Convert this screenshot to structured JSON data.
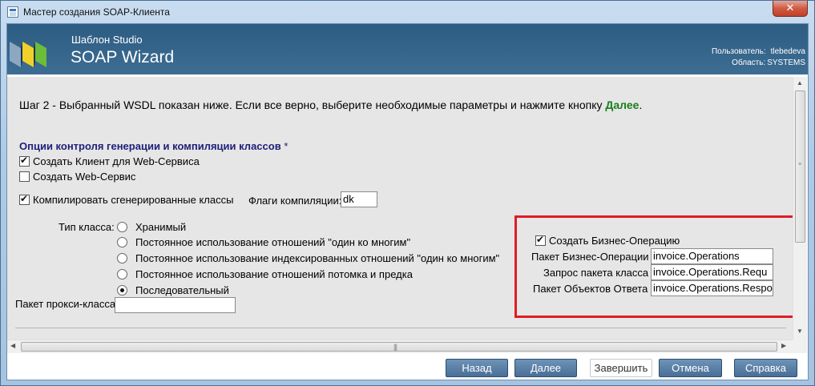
{
  "window": {
    "title": "Мастер создания SOAP-Клиента",
    "close_label": "✕"
  },
  "header": {
    "brand_small": "Шаблон Studio",
    "brand_big": "SOAP Wizard",
    "user_label": "Пользователь:",
    "user_value": "tlebedeva",
    "area_label": "Область:",
    "area_value": "SYSTEMS"
  },
  "content": {
    "step_text": "Шаг 2 - Выбранный WSDL показан ниже. Если все верно, выберите необходимые параметры и нажмите кнопку ",
    "step_next_word": "Далее",
    "step_end": ".",
    "section_title": "Опции контроля генерации и компиляции классов",
    "section_required": "*",
    "create_client_label": "Создать Клиент для Web-Сервиса",
    "create_client_checked": true,
    "create_service_label": "Создать Web-Сервис",
    "create_service_checked": false,
    "compile_label": "Компилировать сгенерированные классы",
    "compile_checked": true,
    "compile_flags_label": "Флаги компиляции:",
    "compile_flags_value": "dk",
    "class_type_label": "Тип класса:",
    "class_types": [
      {
        "label": "Хранимый",
        "checked": false
      },
      {
        "label": "Постоянное использование отношений \"один ко многим\"",
        "checked": false
      },
      {
        "label": "Постоянное использование индексированных отношений \"один ко многим\"",
        "checked": false
      },
      {
        "label": "Постоянное использование отношений потомка и предка",
        "checked": false
      },
      {
        "label": "Последовательный",
        "checked": true
      }
    ],
    "proxy_package_label": "Пакет прокси-класса",
    "proxy_package_value": "",
    "business_op": {
      "create_label": "Создать Бизнес-Операцию",
      "create_checked": true,
      "package_label": "Пакет Бизнес-Операции",
      "package_value": "invoice.Operations",
      "request_label": "Запрос пакета класса",
      "request_value": "invoice.Operations.Requ",
      "response_label": "Пакет Объектов Ответа",
      "response_value": "invoice.Operations.Respo"
    }
  },
  "footer": {
    "back_label": "Назад",
    "next_label": "Далее",
    "finish_label": "Завершить",
    "cancel_label": "Отмена",
    "help_label": "Справка"
  },
  "colors": {
    "banner": "#2d5c83",
    "button": "#4a6f96",
    "highlight_box": "#e01c24",
    "next_word": "#1b7d1b",
    "section_title": "#20207a"
  }
}
